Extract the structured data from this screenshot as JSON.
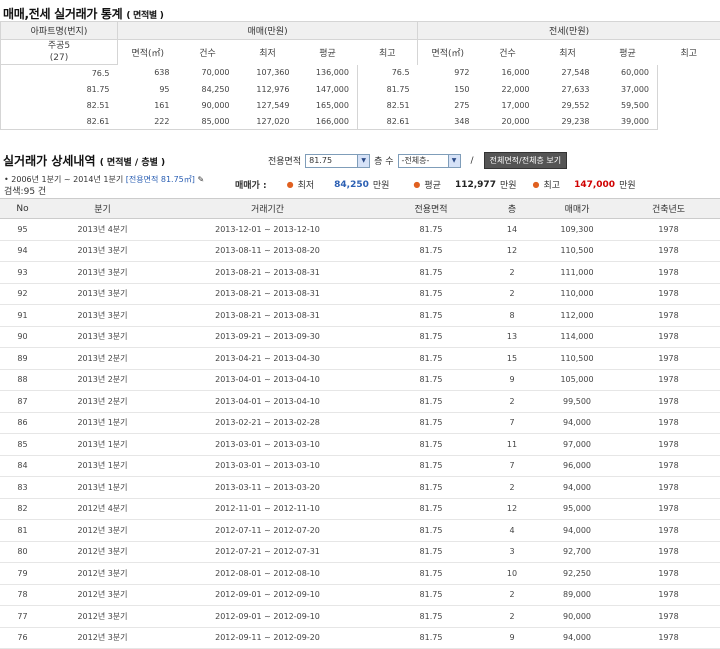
{
  "stats_title": "매매,전세 실거래가 통계",
  "stats_title_sub": "( 면적별 )",
  "stats": {
    "apt_header": "아파트명(번지)",
    "sale_header": "매매(만원)",
    "rent_header": "전세(만원)",
    "sub_headers": [
      "면적(㎡)",
      "건수",
      "최저",
      "평균",
      "최고"
    ],
    "apt_name": "주공5",
    "apt_num": "(27)",
    "sale_rows": [
      [
        "76.5",
        "638",
        "70,000",
        "107,360",
        "136,000"
      ],
      [
        "81.75",
        "95",
        "84,250",
        "112,976",
        "147,000"
      ],
      [
        "82.51",
        "161",
        "90,000",
        "127,549",
        "165,000"
      ],
      [
        "82.61",
        "222",
        "85,000",
        "127,020",
        "166,000"
      ]
    ],
    "rent_rows": [
      [
        "76.5",
        "972",
        "16,000",
        "27,548",
        "60,000"
      ],
      [
        "81.75",
        "150",
        "22,000",
        "27,633",
        "37,000"
      ],
      [
        "82.51",
        "275",
        "17,000",
        "29,552",
        "59,500"
      ],
      [
        "82.61",
        "348",
        "20,000",
        "29,238",
        "39,000"
      ]
    ]
  },
  "detail_title": "실거래가 상세내역",
  "detail_title_sub": "( 면적별 / 층별 )",
  "filter": {
    "area_label": "전용면적",
    "area_value": "81.75",
    "floor_label": "층 수",
    "floor_value": "-전체층-",
    "slash": "/",
    "view_all_button": "전체면적/전체층 보기"
  },
  "info": {
    "period": "• 2006년 1분기 ~ 2014년 1분기",
    "area_tag": "[전용면적 81.75㎡]",
    "count": "검색:95 건",
    "sale_label": "매매가 :",
    "min_label": "최저",
    "min_value": "84,250",
    "avg_label": "평균",
    "avg_value": "112,977",
    "max_label": "최고",
    "max_value": "147,000",
    "unit": "만원"
  },
  "detail": {
    "headers": [
      "No",
      "분기",
      "거래기간",
      "전용면적",
      "층",
      "매매가",
      "건축년도"
    ],
    "rows": [
      [
        "95",
        "2013년 4분기",
        "2013-12-01 ~ 2013-12-10",
        "81.75",
        "14",
        "109,300",
        "1978"
      ],
      [
        "94",
        "2013년 3분기",
        "2013-08-11 ~ 2013-08-20",
        "81.75",
        "12",
        "110,500",
        "1978"
      ],
      [
        "93",
        "2013년 3분기",
        "2013-08-21 ~ 2013-08-31",
        "81.75",
        "2",
        "111,000",
        "1978"
      ],
      [
        "92",
        "2013년 3분기",
        "2013-08-21 ~ 2013-08-31",
        "81.75",
        "2",
        "110,000",
        "1978"
      ],
      [
        "91",
        "2013년 3분기",
        "2013-08-21 ~ 2013-08-31",
        "81.75",
        "8",
        "112,000",
        "1978"
      ],
      [
        "90",
        "2013년 3분기",
        "2013-09-21 ~ 2013-09-30",
        "81.75",
        "13",
        "114,000",
        "1978"
      ],
      [
        "89",
        "2013년 2분기",
        "2013-04-21 ~ 2013-04-30",
        "81.75",
        "15",
        "110,500",
        "1978"
      ],
      [
        "88",
        "2013년 2분기",
        "2013-04-01 ~ 2013-04-10",
        "81.75",
        "9",
        "105,000",
        "1978"
      ],
      [
        "87",
        "2013년 2분기",
        "2013-04-01 ~ 2013-04-10",
        "81.75",
        "2",
        "99,500",
        "1978"
      ],
      [
        "86",
        "2013년 1분기",
        "2013-02-21 ~ 2013-02-28",
        "81.75",
        "7",
        "94,000",
        "1978"
      ],
      [
        "85",
        "2013년 1분기",
        "2013-03-01 ~ 2013-03-10",
        "81.75",
        "11",
        "97,000",
        "1978"
      ],
      [
        "84",
        "2013년 1분기",
        "2013-03-01 ~ 2013-03-10",
        "81.75",
        "7",
        "96,000",
        "1978"
      ],
      [
        "83",
        "2013년 1분기",
        "2013-03-11 ~ 2013-03-20",
        "81.75",
        "2",
        "94,000",
        "1978"
      ],
      [
        "82",
        "2012년 4분기",
        "2012-11-01 ~ 2012-11-10",
        "81.75",
        "12",
        "95,000",
        "1978"
      ],
      [
        "81",
        "2012년 3분기",
        "2012-07-11 ~ 2012-07-20",
        "81.75",
        "4",
        "94,000",
        "1978"
      ],
      [
        "80",
        "2012년 3분기",
        "2012-07-21 ~ 2012-07-31",
        "81.75",
        "3",
        "92,700",
        "1978"
      ],
      [
        "79",
        "2012년 3분기",
        "2012-08-01 ~ 2012-08-10",
        "81.75",
        "10",
        "92,250",
        "1978"
      ],
      [
        "78",
        "2012년 3분기",
        "2012-09-01 ~ 2012-09-10",
        "81.75",
        "2",
        "89,000",
        "1978"
      ],
      [
        "77",
        "2012년 3분기",
        "2012-09-01 ~ 2012-09-10",
        "81.75",
        "2",
        "90,000",
        "1978"
      ],
      [
        "76",
        "2012년 3분기",
        "2012-09-11 ~ 2012-09-20",
        "81.75",
        "9",
        "94,000",
        "1978"
      ]
    ]
  }
}
